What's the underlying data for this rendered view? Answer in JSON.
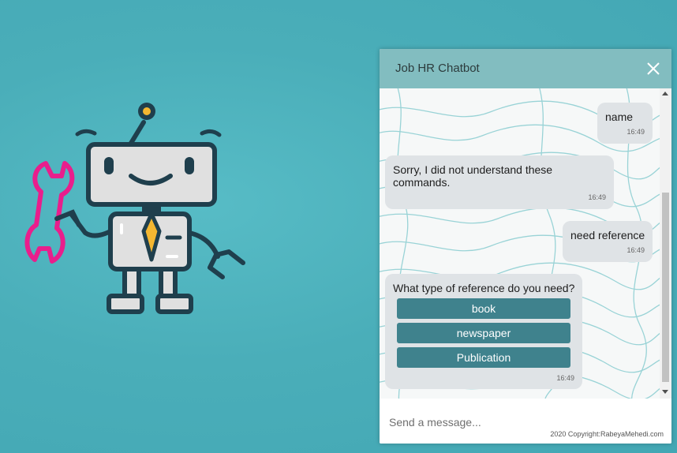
{
  "colors": {
    "background": "#4aaeb9",
    "header": "#82bdc0",
    "bubble": "#dfe3e6",
    "option_button": "#3f828d",
    "robot_outline": "#1f3f4d",
    "robot_face": "#e0e0e0",
    "wrench": "#e91e8c",
    "tie": "#f4b731"
  },
  "illustration": {
    "name": "robot-mascot",
    "icons": [
      "robot-icon",
      "wrench-icon"
    ]
  },
  "chat": {
    "title": "Job HR Chatbot",
    "close_icon": "close-icon",
    "messages": [
      {
        "sender": "user",
        "text": "name",
        "time": "16:49"
      },
      {
        "sender": "bot",
        "text": "Sorry, I did not understand these commands.",
        "time": "16:49"
      },
      {
        "sender": "user",
        "text": "need reference",
        "time": "16:49"
      },
      {
        "sender": "bot",
        "text": "What type of reference do you need?",
        "time": "16:49",
        "options": [
          "book",
          "newspaper",
          "Publication"
        ]
      }
    ],
    "input": {
      "placeholder": "Send a message..."
    },
    "copyright": "2020 Copyright:RabeyaMehedi.com"
  }
}
